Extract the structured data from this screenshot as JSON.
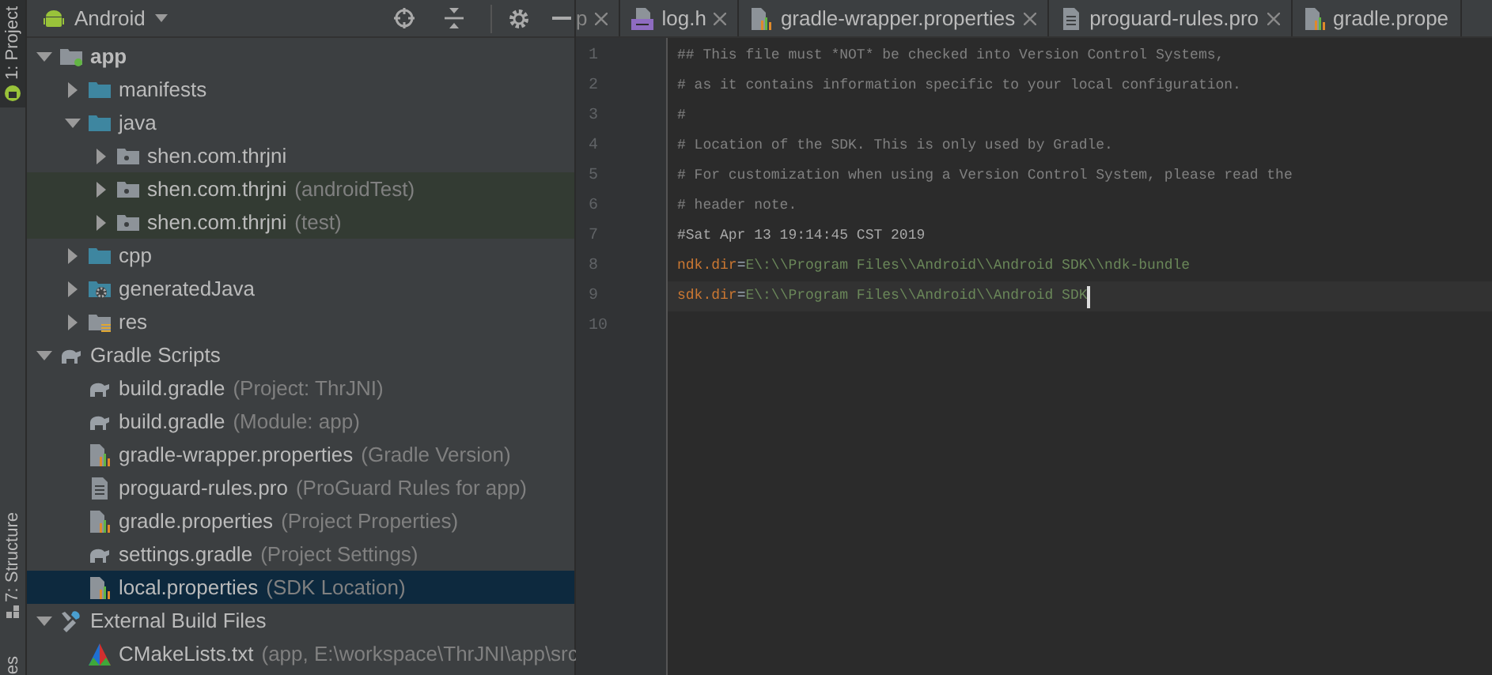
{
  "tool_stripe": {
    "top_tab": {
      "label": "1: Project",
      "selected": true
    },
    "bottom_tabs": [
      {
        "label": "7: Structure"
      },
      {
        "label": "es"
      }
    ]
  },
  "project_panel": {
    "view": "Android",
    "tree": [
      {
        "label": "app",
        "kind": "module",
        "expanded": true,
        "bold": true,
        "selected": false,
        "tinted": false,
        "children": [
          {
            "label": "manifests",
            "kind": "folder",
            "expanded": false,
            "bold": false,
            "selected": false,
            "tinted": false
          },
          {
            "label": "java",
            "kind": "folder",
            "expanded": true,
            "bold": false,
            "selected": false,
            "tinted": false,
            "children": [
              {
                "label": "shen.com.thrjni",
                "kind": "package",
                "expanded": false,
                "bold": false,
                "selected": false,
                "tinted": false
              },
              {
                "label": "shen.com.thrjni",
                "note": "(androidTest)",
                "kind": "package",
                "expanded": false,
                "bold": false,
                "selected": false,
                "tinted": true
              },
              {
                "label": "shen.com.thrjni",
                "note": "(test)",
                "kind": "package",
                "expanded": false,
                "bold": false,
                "selected": false,
                "tinted": true
              }
            ]
          },
          {
            "label": "cpp",
            "kind": "folder",
            "expanded": false,
            "bold": false,
            "selected": false,
            "tinted": false
          },
          {
            "label": "generatedJava",
            "kind": "generated",
            "expanded": false,
            "bold": false,
            "selected": false,
            "tinted": false
          },
          {
            "label": "res",
            "kind": "res",
            "expanded": false,
            "bold": false,
            "selected": false,
            "tinted": false
          }
        ]
      },
      {
        "label": "Gradle Scripts",
        "kind": "gradle",
        "expanded": true,
        "bold": false,
        "selected": false,
        "tinted": false,
        "children": [
          {
            "label": "build.gradle",
            "note": "(Project: ThrJNI)",
            "kind": "gradle",
            "bold": false,
            "selected": false,
            "tinted": false
          },
          {
            "label": "build.gradle",
            "note": "(Module: app)",
            "kind": "gradle",
            "bold": false,
            "selected": false,
            "tinted": false
          },
          {
            "label": "gradle-wrapper.properties",
            "note": "(Gradle Version)",
            "kind": "properties",
            "bold": false,
            "selected": false,
            "tinted": false
          },
          {
            "label": "proguard-rules.pro",
            "note": "(ProGuard Rules for app)",
            "kind": "text",
            "bold": false,
            "selected": false,
            "tinted": false
          },
          {
            "label": "gradle.properties",
            "note": "(Project Properties)",
            "kind": "properties",
            "bold": false,
            "selected": false,
            "tinted": false
          },
          {
            "label": "settings.gradle",
            "note": "(Project Settings)",
            "kind": "gradle",
            "bold": false,
            "selected": false,
            "tinted": false
          },
          {
            "label": "local.properties",
            "note": "(SDK Location)",
            "kind": "properties",
            "bold": false,
            "selected": true,
            "tinted": false
          }
        ]
      },
      {
        "label": "External Build Files",
        "kind": "tools",
        "expanded": true,
        "bold": false,
        "selected": false,
        "tinted": false,
        "children": [
          {
            "label": "CMakeLists.txt",
            "note": "(app, E:\\workspace\\ThrJNI\\app\\src",
            "kind": "cmake",
            "bold": false,
            "selected": false,
            "tinted": false
          }
        ]
      }
    ]
  },
  "editor": {
    "tabs": [
      {
        "label": "p",
        "kind": "none"
      },
      {
        "label": "log.h",
        "kind": "cpp"
      },
      {
        "label": "gradle-wrapper.properties",
        "kind": "properties"
      },
      {
        "label": "proguard-rules.pro",
        "kind": "text"
      },
      {
        "label": "gradle.prope",
        "kind": "properties"
      }
    ],
    "lines": [
      {
        "number": "1",
        "current": false,
        "tokens": [
          {
            "kind": "comment",
            "text": "## This file must *NOT* be checked into Version Control Systems,"
          }
        ]
      },
      {
        "number": "2",
        "current": false,
        "tokens": [
          {
            "kind": "comment",
            "text": "# as it contains information specific to your local configuration."
          }
        ]
      },
      {
        "number": "3",
        "current": false,
        "tokens": [
          {
            "kind": "comment",
            "text": "#"
          }
        ]
      },
      {
        "number": "4",
        "current": false,
        "tokens": [
          {
            "kind": "comment",
            "text": "# Location of the SDK. This is only used by Gradle."
          }
        ]
      },
      {
        "number": "5",
        "current": false,
        "tokens": [
          {
            "kind": "comment",
            "text": "# For customization when using a Version Control System, please read the"
          }
        ]
      },
      {
        "number": "6",
        "current": false,
        "tokens": [
          {
            "kind": "comment",
            "text": "# header note."
          }
        ]
      },
      {
        "number": "7",
        "current": false,
        "tokens": [
          {
            "kind": "date",
            "text": "#Sat Apr 13 19:14:45 CST 2019"
          }
        ]
      },
      {
        "number": "8",
        "current": false,
        "tokens": [
          {
            "kind": "key",
            "text": "ndk.dir"
          },
          {
            "kind": "sep",
            "text": "="
          },
          {
            "kind": "value",
            "text": "E\\:\\\\Program Files\\\\Android\\\\Android SDK\\\\ndk-bundle"
          }
        ]
      },
      {
        "number": "9",
        "current": true,
        "tokens": [
          {
            "kind": "key",
            "text": "sdk.dir"
          },
          {
            "kind": "sep",
            "text": "="
          },
          {
            "kind": "value",
            "text": "E\\:\\\\Program Files\\\\Android\\\\Android SDK"
          }
        ]
      },
      {
        "number": "10",
        "current": false
      }
    ]
  }
}
